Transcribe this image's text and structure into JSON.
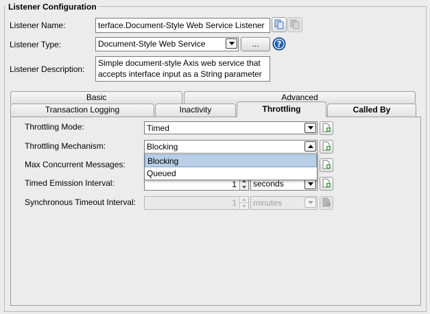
{
  "group": {
    "title": "Listener Configuration"
  },
  "listener": {
    "name_label": "Listener Name:",
    "name_value": "terface.Document-Style Web Service  Listener",
    "type_label": "Listener Type:",
    "type_value": "Document-Style Web Service",
    "browse_label": "...",
    "description_label": "Listener Description:",
    "description_value": "Simple document-style Axis web service that accepts interface input as a String parameter"
  },
  "tabs": {
    "row1": [
      {
        "label": "Basic"
      },
      {
        "label": "Advanced"
      }
    ],
    "row2": [
      {
        "label": "Transaction Logging"
      },
      {
        "label": "Inactivity"
      },
      {
        "label": "Throttling",
        "selected": true
      },
      {
        "label": "Called By"
      }
    ]
  },
  "throttling": {
    "mode_label": "Throttling Mode:",
    "mode_value": "Timed",
    "mechanism_label": "Throttling Mechanism:",
    "mechanism_value": "Blocking",
    "mechanism_options": [
      "Blocking",
      "Queued"
    ],
    "max_concurrent_label": "Max Concurrent Messages:",
    "emission_label": "Timed Emission Interval:",
    "emission_value": "1",
    "emission_unit": "seconds",
    "sync_timeout_label": "Synchronous Timeout Interval:",
    "sync_timeout_value": "1",
    "sync_timeout_unit": "minutes"
  },
  "icons": {
    "copy": "copy-icon",
    "help": "help-icon",
    "new_document": "new-document-icon"
  },
  "colors": {
    "help_blue": "#1f5fb0",
    "selected_item": "#b8cfe5",
    "icon_green": "#3aa63a"
  }
}
